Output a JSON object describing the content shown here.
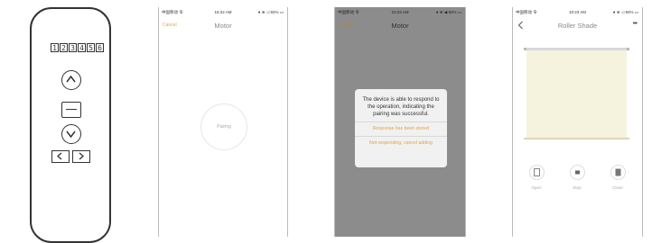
{
  "remote": {
    "channels": [
      "1",
      "2",
      "3",
      "4",
      "5",
      "6"
    ]
  },
  "status_bar": {
    "carrier": "中国移动 令",
    "phone1_time": "16:22 AM",
    "phone2_time": "10:23 AM",
    "phone3_time": "10:23 AM",
    "battery1": "● ⊕ ◁ 92% ▭",
    "battery2": "● ⊕ ◀ 92% ▭",
    "battery3": "● ⊕ ◁ 92% ▭"
  },
  "pairing_screen": {
    "cancel": "Cancel",
    "title": "Motor",
    "pairing_label": "Pairing"
  },
  "confirm_screen": {
    "cancel": "Cancel",
    "title": "Motor",
    "dialog_message": "The device is able to respond to the operation, indicating the pairing was successful.",
    "option_stored": "Response has been stored",
    "option_not_responding": "Not responding, cancel adding"
  },
  "shade_screen": {
    "title": "Roller Shade",
    "more": "•••",
    "open_label": "Open",
    "stop_label": "Stop",
    "close_label": "Close"
  },
  "colors": {
    "accent": "#e6a23c",
    "overlay": "#8c8c8c",
    "shade": "#f5f3de"
  }
}
